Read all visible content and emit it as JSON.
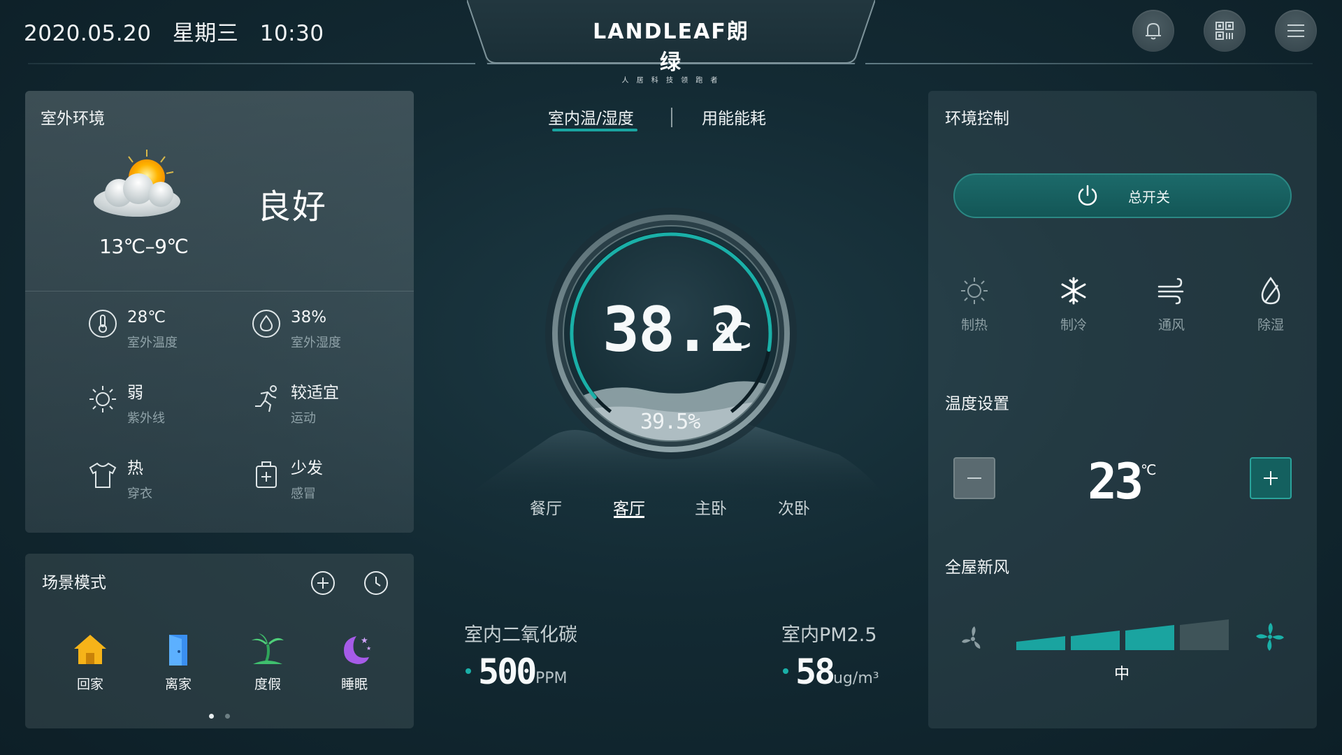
{
  "header": {
    "date": "2020.05.20",
    "weekday": "星期三",
    "time": "10:30",
    "logo_text": "LANDLEAF朗绿",
    "logo_tagline": "人 居 科 技 领 跑 者",
    "icons": [
      "bell-icon",
      "qr-code-icon",
      "menu-icon"
    ]
  },
  "outdoor": {
    "title": "室外环境",
    "temp_range": "13℃–9℃",
    "quality": "良好",
    "stats": [
      {
        "value": "28℃",
        "label": "室外温度",
        "icon": "thermometer-icon"
      },
      {
        "value": "38%",
        "label": "室外湿度",
        "icon": "water-drop-icon"
      },
      {
        "value": "弱",
        "label": "紫外线",
        "icon": "sun-icon"
      },
      {
        "value": "较适宜",
        "label": "运动",
        "icon": "running-icon"
      },
      {
        "value": "热",
        "label": "穿衣",
        "icon": "shirt-icon"
      },
      {
        "value": "少发",
        "label": "感冒",
        "icon": "medkit-icon"
      }
    ]
  },
  "scene": {
    "title": "场景模式",
    "items": [
      {
        "label": "回家",
        "icon": "home-icon"
      },
      {
        "label": "离家",
        "icon": "door-icon"
      },
      {
        "label": "度假",
        "icon": "palm-tree-icon"
      },
      {
        "label": "睡眠",
        "icon": "moon-icon"
      }
    ],
    "page_count": 2,
    "current_page": 1
  },
  "center": {
    "tabs": [
      "室内温/湿度",
      "用能能耗"
    ],
    "active_tab": 0,
    "temperature": "38.2",
    "temperature_unit": "℃",
    "humidity": "39.5%",
    "gauge_fraction": 0.82,
    "rooms": [
      "餐厅",
      "客厅",
      "主卧",
      "次卧"
    ],
    "active_room": 1,
    "co2": {
      "title": "室内二氧化碳",
      "value": "500",
      "unit": "PPM"
    },
    "pm25": {
      "title": "室内PM2.5",
      "value": "58",
      "unit": "ug/m³"
    }
  },
  "env_control": {
    "title": "环境控制",
    "master_switch": "总开关",
    "modes": [
      {
        "label": "制热",
        "icon": "sun-icon"
      },
      {
        "label": "制冷",
        "icon": "snowflake-icon"
      },
      {
        "label": "通风",
        "icon": "wind-icon"
      },
      {
        "label": "除湿",
        "icon": "dehumidify-icon"
      }
    ],
    "temp_title": "温度设置",
    "set_temp": "23",
    "set_temp_unit": "℃",
    "fresh_air_title": "全屋新风",
    "fan_levels": 4,
    "fan_level": 3,
    "fan_level_label": "中",
    "colors": {
      "accent": "#1aa4a0",
      "inactive": "#3f5459"
    }
  }
}
